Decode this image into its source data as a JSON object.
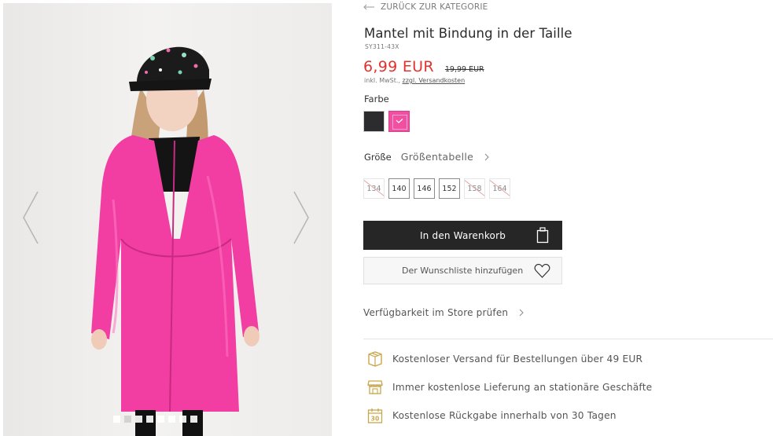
{
  "product": {
    "back_label": "ZURÜCK ZUR KATEGORIE",
    "title": "Mantel mit Bindung in der Taille",
    "sku": "SY311-43X",
    "price": "6,99 EUR",
    "old_price": "19,99 EUR",
    "tax_text": "inkl. MwSt., ",
    "shipping_link": "zzgl. Versandkosten"
  },
  "color": {
    "label": "Farbe",
    "swatches": [
      {
        "name": "black",
        "hex": "#2c2c2e",
        "selected": false
      },
      {
        "name": "pink",
        "hex": "#f04fa2",
        "selected": true
      }
    ]
  },
  "size": {
    "label": "Größe",
    "table_link": "Größentabelle",
    "options": [
      {
        "value": "134",
        "available": false
      },
      {
        "value": "140",
        "available": true
      },
      {
        "value": "146",
        "available": true
      },
      {
        "value": "152",
        "available": true
      },
      {
        "value": "158",
        "available": false
      },
      {
        "value": "164",
        "available": false
      }
    ]
  },
  "actions": {
    "add_to_cart": "In den Warenkorb",
    "add_to_wishlist": "Der Wunschliste hinzufügen",
    "store_availability": "Verfügbarkeit im Store prüfen"
  },
  "benefits": [
    {
      "icon": "delivery-box-icon",
      "text": "Kostenloser Versand für Bestellungen über 49 EUR"
    },
    {
      "icon": "store-icon",
      "text": "Immer kostenlose Lieferung an stationäre Geschäfte"
    },
    {
      "icon": "calendar-30-icon",
      "text": "Kostenlose Rückgabe innerhalb von 30 Tagen"
    }
  ],
  "gallery": {
    "slide_count": 8,
    "active_slide": 1,
    "icons": {
      "prev": "chevron-left-icon",
      "next": "chevron-right-icon"
    }
  },
  "colors": {
    "accent_price": "#e0332e",
    "button_dark": "#262626",
    "brand_gold": "#c9a64a"
  }
}
